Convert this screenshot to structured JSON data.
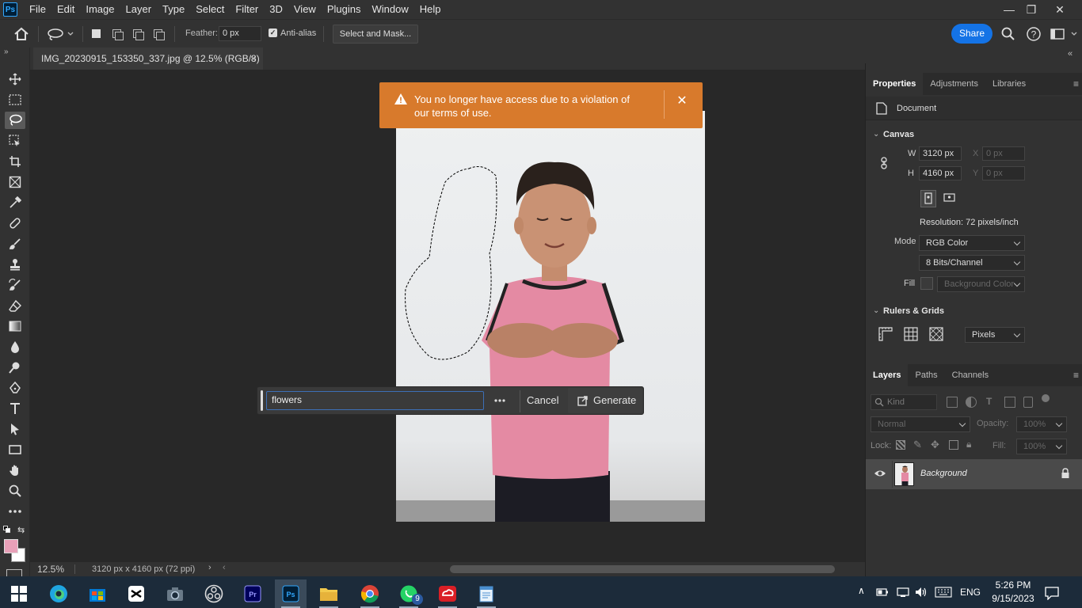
{
  "app": {
    "logo": "Ps"
  },
  "menu": [
    "File",
    "Edit",
    "Image",
    "Layer",
    "Type",
    "Select",
    "Filter",
    "3D",
    "View",
    "Plugins",
    "Window",
    "Help"
  ],
  "options": {
    "feather_label": "Feather:",
    "feather_value": "0 px",
    "antialias_label": "Anti-alias",
    "select_mask_label": "Select and Mask...",
    "share_label": "Share"
  },
  "document": {
    "tab_title": "IMG_20230915_153350_337.jpg @ 12.5% (RGB/8)",
    "zoom": "12.5%",
    "dimensions": "3120 px x 4160 px (72 ppi)"
  },
  "alert": {
    "message": "You no longer have access due to a violation of our terms of use."
  },
  "generative_bar": {
    "prompt_value": "flowers",
    "cancel_label": "Cancel",
    "generate_label": "Generate"
  },
  "properties": {
    "tabs": [
      "Properties",
      "Adjustments",
      "Libraries"
    ],
    "document_label": "Document",
    "canvas_heading": "Canvas",
    "w_label": "W",
    "w_value": "3120 px",
    "h_label": "H",
    "h_value": "4160 px",
    "x_label": "X",
    "x_placeholder": "0 px",
    "y_label": "Y",
    "y_placeholder": "0 px",
    "resolution": "Resolution: 72 pixels/inch",
    "mode_label": "Mode",
    "mode_value": "RGB Color",
    "bits_value": "8 Bits/Channel",
    "fill_label": "Fill",
    "fill_value": "Background Color",
    "rulers_heading": "Rulers & Grids",
    "units_value": "Pixels"
  },
  "layers": {
    "tabs": [
      "Layers",
      "Paths",
      "Channels"
    ],
    "kind_label": "Kind",
    "blend_mode": "Normal",
    "opacity_label": "Opacity:",
    "opacity_value": "100%",
    "lock_label": "Lock:",
    "fill_label": "Fill:",
    "fill_value": "100%",
    "items": [
      {
        "name": "Background"
      }
    ]
  },
  "taskbar": {
    "time": "5:26 PM",
    "date": "9/15/2023",
    "language": "ENG",
    "whatsapp_badge": "9"
  },
  "colors": {
    "alert_bg": "#d87a2c",
    "foreground_swatch": "#e8a0b8",
    "share_button": "#1473e6"
  }
}
